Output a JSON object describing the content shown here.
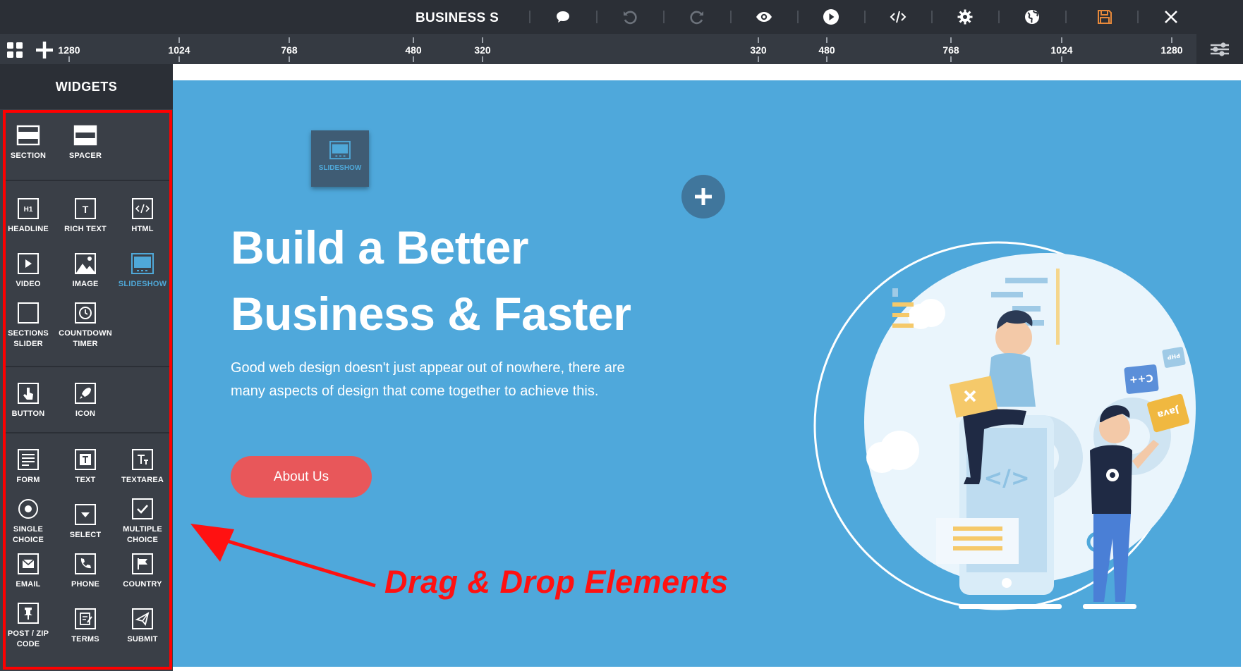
{
  "topbar": {
    "title": "BUSINESS S",
    "icons": [
      "comment-icon",
      "undo-icon",
      "redo-icon",
      "preview-eye-icon",
      "play-icon",
      "code-icon",
      "gear-icon",
      "globe-icon",
      "save-icon",
      "close-icon"
    ],
    "save_color": "#e8893a"
  },
  "ruler": {
    "left_ticks": [
      "1280",
      "1024",
      "768",
      "480",
      "320"
    ],
    "right_ticks": [
      "320",
      "480",
      "768",
      "1024",
      "1280"
    ]
  },
  "sidebar": {
    "title": "WIDGETS",
    "widgets": {
      "section": "SECTION",
      "spacer": "SPACER",
      "headline": "HEADLINE",
      "rich_text": "RICH TEXT",
      "html": "HTML",
      "video": "VIDEO",
      "image": "IMAGE",
      "slideshow": "SLIDESHOW",
      "sections_slider": "SECTIONS SLIDER",
      "countdown_timer": "COUNTDOWN TIMER",
      "button": "BUTTON",
      "icon": "ICON",
      "form": "FORM",
      "text": "TEXT",
      "textarea": "TEXTAREA",
      "single_choice": "SINGLE CHOICE",
      "select": "SELECT",
      "multiple_choice": "MULTIPLE CHOICE",
      "email": "EMAIL",
      "phone": "PHONE",
      "country": "COUNTRY",
      "post_zip": "POST / ZIP CODE",
      "terms": "TERMS",
      "submit": "SUBMIT"
    },
    "icon_glyphs": {
      "headline": "H1",
      "rich_text": "T"
    },
    "active_color": "#4fa8d8"
  },
  "canvas": {
    "dragging_widget": "SLIDESHOW",
    "headline_line1": "Build a Better",
    "headline_line2": "Business & Faster",
    "subtext": "Good web design doesn't just appear out of nowhere, there are many aspects of design that come together to achieve this.",
    "cta_label": "About Us",
    "hero_color": "#4fa8db",
    "cta_color": "#e8575a",
    "illustration": {
      "cpp_card": "C++",
      "java_card": "Java",
      "php_card": "PHP",
      "code_tag": "</>"
    }
  },
  "annotation": {
    "text": "Drag & Drop Elements",
    "color": "#ff1111"
  }
}
